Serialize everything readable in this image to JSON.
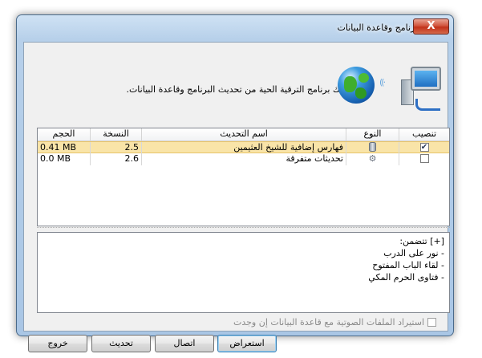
{
  "window": {
    "title": "ترقية البرنامج وقاعدة البيانات",
    "close_label": "X"
  },
  "intro": {
    "text": "يمكنك برنامج الترقية الحية من تحديث البرنامج وقاعدة البيانات."
  },
  "icons": {
    "globe": "globe-icon",
    "computer": "computer-network-icon",
    "signal": "wireless-signal-icon"
  },
  "table": {
    "columns": {
      "install": "تنصيب",
      "type": "النوع",
      "name": "اسم التحديث",
      "version": "النسخة",
      "size": "الحجم"
    },
    "rows": [
      {
        "installed": true,
        "type_icon": "database-icon",
        "name": "فهارس إضافية للشيخ العثيمين",
        "version": "2.5",
        "size": "0.41 MB",
        "selected": true
      },
      {
        "installed": false,
        "type_icon": "gear-icon",
        "name": "تحديثات متفرقة",
        "version": "2.6",
        "size": "0.0 MB",
        "selected": false
      }
    ]
  },
  "details": {
    "heading": "[+] تتضمن:",
    "lines": [
      "- نور على الدرب",
      "- لقاء الباب المفتوح",
      "- فتاوى الحرم المكي"
    ]
  },
  "options": {
    "import_audio": "استيراد الملفات الصوتية مع قاعدة البيانات إن وجدت",
    "import_audio_checked": false
  },
  "buttons": {
    "browse": "استعراض",
    "connect": "اتصال",
    "update": "تحديث",
    "exit": "خروج"
  }
}
